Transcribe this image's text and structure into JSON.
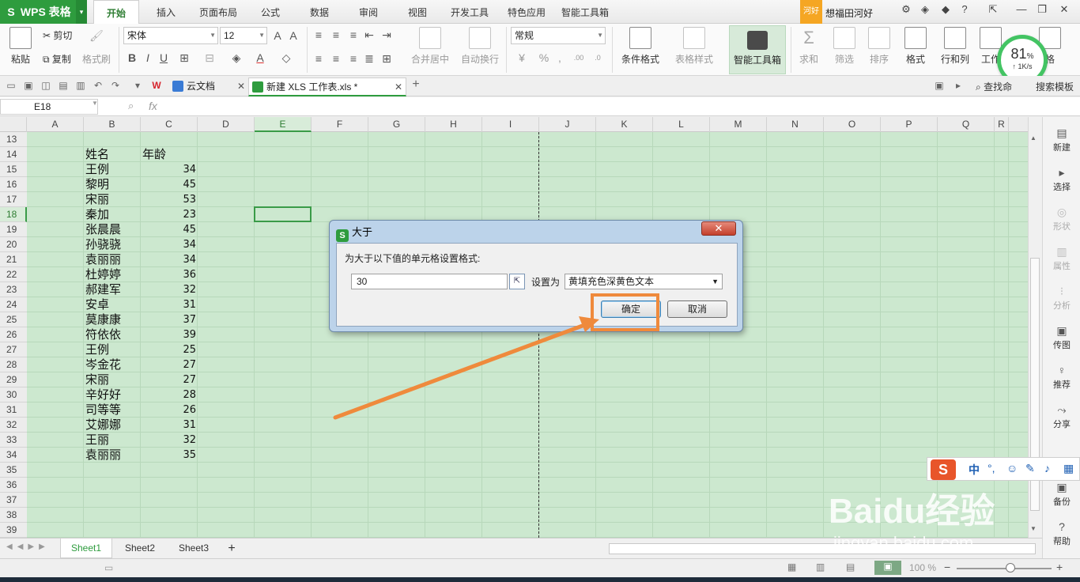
{
  "app": {
    "name": "WPS 表格",
    "logo": "S"
  },
  "menu": {
    "tabs": [
      {
        "label": "开始",
        "active": true
      },
      {
        "label": "插入"
      },
      {
        "label": "页面布局"
      },
      {
        "label": "公式"
      },
      {
        "label": "数据"
      },
      {
        "label": "审阅"
      },
      {
        "label": "视图"
      },
      {
        "label": "开发工具"
      },
      {
        "label": "特色应用"
      },
      {
        "label": "智能工具箱"
      }
    ],
    "user_badge": "河好",
    "user_name": "想福田河好"
  },
  "ribbon": {
    "paste": "粘贴",
    "cut": "剪切",
    "copy": "复制",
    "format_painter": "格式刷",
    "font_name": "宋体",
    "font_size": "12",
    "number_format": "常规",
    "merge_center": "合并居中",
    "wrap_text": "自动换行",
    "conditional_format": "条件格式",
    "table_style": "表格样式",
    "smart_toolbox": "智能工具箱",
    "sum": "求和",
    "filter": "筛选",
    "sort": "排序",
    "format": "格式",
    "row_col": "行和列",
    "worksheet": "工作",
    "cell_style": "格",
    "find": "查找命",
    "search_template": "搜索模板"
  },
  "gauge": {
    "percent": "81",
    "unit": "%",
    "speed": "1K/s"
  },
  "tabs": [
    {
      "label": "云文档",
      "active": false
    },
    {
      "label": "新建 XLS 工作表.xls *",
      "active": true
    }
  ],
  "formula_bar": {
    "name_box": "E18",
    "fx": "fx"
  },
  "columns": [
    "A",
    "B",
    "C",
    "D",
    "E",
    "F",
    "G",
    "H",
    "I",
    "J",
    "K",
    "L",
    "M",
    "N",
    "O",
    "P",
    "Q",
    "R"
  ],
  "rows": [
    "13",
    "14",
    "15",
    "16",
    "17",
    "18",
    "19",
    "20",
    "21",
    "22",
    "23",
    "24",
    "25",
    "26",
    "27",
    "28",
    "29",
    "30",
    "31",
    "32",
    "33",
    "34",
    "35",
    "36",
    "37",
    "38",
    "39"
  ],
  "table": {
    "header": {
      "name": "姓名",
      "age": "年龄"
    },
    "records": [
      {
        "name": "王例",
        "age": "34"
      },
      {
        "name": "黎明",
        "age": "45"
      },
      {
        "name": "宋丽",
        "age": "53"
      },
      {
        "name": "秦加",
        "age": "23"
      },
      {
        "name": "张晨晨",
        "age": "45"
      },
      {
        "name": "孙骁骁",
        "age": "34"
      },
      {
        "name": "袁丽丽",
        "age": "34"
      },
      {
        "name": "杜婷婷",
        "age": "36"
      },
      {
        "name": "郝建军",
        "age": "32"
      },
      {
        "name": "安卓",
        "age": "31"
      },
      {
        "name": "莫康康",
        "age": "37"
      },
      {
        "name": "符依依",
        "age": "39"
      },
      {
        "name": "王例",
        "age": "25"
      },
      {
        "name": "岑金花",
        "age": "27"
      },
      {
        "name": "宋丽",
        "age": "27"
      },
      {
        "name": "辛好好",
        "age": "28"
      },
      {
        "name": "司等等",
        "age": "26"
      },
      {
        "name": "艾娜娜",
        "age": "31"
      },
      {
        "name": "王丽",
        "age": "32"
      },
      {
        "name": "袁丽丽",
        "age": "35"
      }
    ]
  },
  "dialog": {
    "title": "大于",
    "label": "为大于以下值的单元格设置格式:",
    "value": "30",
    "set_as": "设置为",
    "format_option": "黄填充色深黄色文本",
    "ok": "确定",
    "cancel": "取消"
  },
  "sheets": [
    "Sheet1",
    "Sheet2",
    "Sheet3"
  ],
  "right_pane": [
    {
      "label": "新建",
      "icon": "new-icon",
      "enabled": true
    },
    {
      "label": "选择",
      "icon": "select-icon",
      "enabled": true
    },
    {
      "label": "形状",
      "icon": "shape-icon",
      "enabled": false
    },
    {
      "label": "属性",
      "icon": "property-icon",
      "enabled": false
    },
    {
      "label": "分析",
      "icon": "analysis-icon",
      "enabled": false
    },
    {
      "label": "传图",
      "icon": "upload-image-icon",
      "enabled": true
    },
    {
      "label": "推荐",
      "icon": "recommend-icon",
      "enabled": true
    },
    {
      "label": "分享",
      "icon": "share-icon",
      "enabled": true
    },
    {
      "label": "备份",
      "icon": "backup-icon",
      "enabled": true
    },
    {
      "label": "帮助",
      "icon": "help-icon",
      "enabled": true
    }
  ],
  "status": {
    "zoom": "100 %"
  },
  "ime": {
    "lang": "中"
  },
  "watermark": {
    "brand": "Baidu经验",
    "url": "jingyan.baidu.com"
  },
  "colors": {
    "brand_green": "#2e9c3e",
    "grid_bg": "#cce8cf",
    "annotation": "#ef8a3c"
  }
}
